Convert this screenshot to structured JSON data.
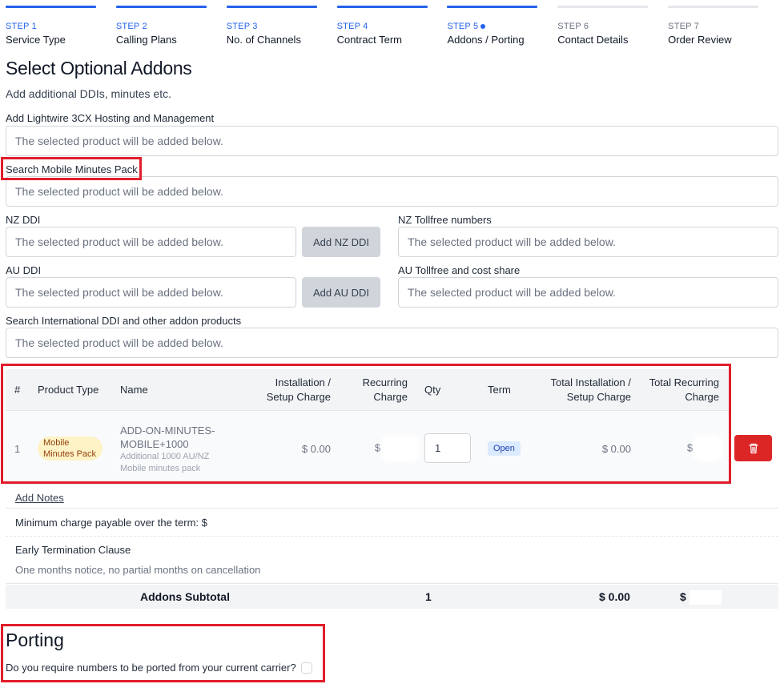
{
  "stepper": {
    "steps": [
      {
        "num": "STEP 1",
        "name": "Service Type",
        "state": "done"
      },
      {
        "num": "STEP 2",
        "name": "Calling Plans",
        "state": "done"
      },
      {
        "num": "STEP 3",
        "name": "No. of Channels",
        "state": "done"
      },
      {
        "num": "STEP 4",
        "name": "Contract Term",
        "state": "done"
      },
      {
        "num": "STEP 5",
        "name": "Addons / Porting",
        "state": "current"
      },
      {
        "num": "STEP 6",
        "name": "Contact Details",
        "state": "future"
      },
      {
        "num": "STEP 7",
        "name": "Order Review",
        "state": "future"
      }
    ]
  },
  "addons": {
    "title": "Select Optional Addons",
    "subtitle": "Add additional DDIs, minutes etc.",
    "hosting_label": "Add Lightwire 3CX Hosting and Management",
    "mobile_label": "Search Mobile Minutes Pack",
    "nz_ddi_label": "NZ DDI",
    "nz_tollfree_label": "NZ Tollfree numbers",
    "au_ddi_label": "AU DDI",
    "au_tollfree_label": "AU Tollfree and cost share",
    "intl_label": "Search International DDI and other addon products",
    "placeholder": "The selected product will be added below.",
    "add_nz_ddi": "Add NZ DDI",
    "add_au_ddi": "Add AU DDI"
  },
  "table": {
    "headers": {
      "num": "#",
      "product_type": "Product Type",
      "name": "Name",
      "install_1": "Installation /",
      "install_2": "Setup Charge",
      "recurring_1": "Recurring",
      "recurring_2": "Charge",
      "qty": "Qty",
      "term": "Term",
      "total_install_1": "Total Installation /",
      "total_install_2": "Setup Charge",
      "total_recurring_1": "Total Recurring",
      "total_recurring_2": "Charge"
    },
    "rows": [
      {
        "num": "1",
        "product_type_1": "Mobile",
        "product_type_2": "Minutes Pack",
        "name_1": "ADD-ON-MINUTES-",
        "name_2": "MOBILE+1000",
        "desc_1": "Additional 1000 AU/NZ",
        "desc_2": "Mobile minutes pack",
        "install": "$ 0.00",
        "recurring": "$",
        "qty": "1",
        "term": "Open",
        "total_install": "$ 0.00",
        "total_recurring": "$"
      }
    ]
  },
  "notes": {
    "add_notes": "Add Notes",
    "min_charge": "Minimum charge payable over the term: $",
    "etc_title": "Early Termination Clause",
    "etc_text": "One months notice, no partial months on cancellation"
  },
  "subtotal": {
    "label": "Addons Subtotal",
    "qty": "1",
    "install": "$ 0.00",
    "recurring": "$"
  },
  "porting": {
    "title": "Porting",
    "question": "Do you require numbers to be ported from your current carrier?"
  },
  "colors": {
    "accent": "#2563eb",
    "highlight_red": "#e11d2b",
    "delete_red": "#dc2626"
  }
}
